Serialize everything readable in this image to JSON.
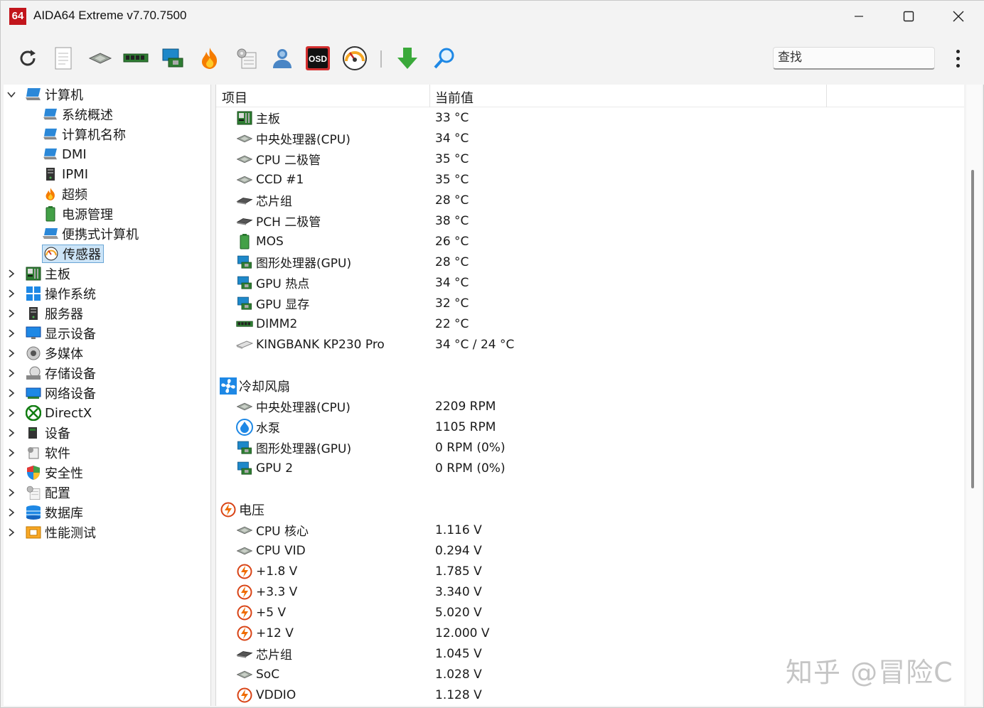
{
  "window": {
    "app_logo": "64",
    "title": "AIDA64 Extreme v7.70.7500"
  },
  "toolbar": {
    "icons": [
      "refresh-icon",
      "report-icon",
      "cpu-icon",
      "memory-icon",
      "gpu-card-icon",
      "overclock-flame-icon",
      "config-icon",
      "user-icon",
      "osd-icon",
      "gauge-icon",
      "download-arrow-icon",
      "search-magnifier-icon"
    ],
    "osd_label": "OSD",
    "search_placeholder": "查找"
  },
  "tree": {
    "root": {
      "label": "计算机",
      "expanded": true
    },
    "children": [
      {
        "label": "系统概述",
        "icon": "computer-icon"
      },
      {
        "label": "计算机名称",
        "icon": "computer-icon"
      },
      {
        "label": "DMI",
        "icon": "computer-icon"
      },
      {
        "label": "IPMI",
        "icon": "server-icon"
      },
      {
        "label": "超频",
        "icon": "flame-icon"
      },
      {
        "label": "电源管理",
        "icon": "battery-icon"
      },
      {
        "label": "便携式计算机",
        "icon": "laptop-icon"
      },
      {
        "label": "传感器",
        "icon": "gauge-icon",
        "selected": true
      }
    ],
    "categories": [
      {
        "label": "主板",
        "icon": "motherboard-icon"
      },
      {
        "label": "操作系统",
        "icon": "windows-icon"
      },
      {
        "label": "服务器",
        "icon": "server-icon"
      },
      {
        "label": "显示设备",
        "icon": "monitor-icon"
      },
      {
        "label": "多媒体",
        "icon": "speaker-icon"
      },
      {
        "label": "存储设备",
        "icon": "storage-icon"
      },
      {
        "label": "网络设备",
        "icon": "network-icon"
      },
      {
        "label": "DirectX",
        "icon": "xbox-icon"
      },
      {
        "label": "设备",
        "icon": "device-icon"
      },
      {
        "label": "软件",
        "icon": "software-icon"
      },
      {
        "label": "安全性",
        "icon": "shield-icon"
      },
      {
        "label": "配置",
        "icon": "config-icon"
      },
      {
        "label": "数据库",
        "icon": "database-icon"
      },
      {
        "label": "性能测试",
        "icon": "benchmark-icon"
      }
    ]
  },
  "panel": {
    "col_item": "项目",
    "col_value": "当前值",
    "temperatures": [
      {
        "name": "主板",
        "value": "33 °C",
        "icon": "motherboard-icon"
      },
      {
        "name": "中央处理器(CPU)",
        "value": "34 °C",
        "icon": "cpu-icon"
      },
      {
        "name": "CPU 二极管",
        "value": "35 °C",
        "icon": "cpu-icon"
      },
      {
        "name": "CCD #1",
        "value": "35 °C",
        "icon": "cpu-icon"
      },
      {
        "name": "芯片组",
        "value": "28 °C",
        "icon": "chip-icon"
      },
      {
        "name": "PCH 二极管",
        "value": "38 °C",
        "icon": "chip-icon"
      },
      {
        "name": "MOS",
        "value": "26 °C",
        "icon": "battery-icon"
      },
      {
        "name": "图形处理器(GPU)",
        "value": "28 °C",
        "icon": "gpu-icon"
      },
      {
        "name": "GPU 热点",
        "value": "34 °C",
        "icon": "gpu-icon"
      },
      {
        "name": "GPU 显存",
        "value": "32 °C",
        "icon": "gpu-icon"
      },
      {
        "name": "DIMM2",
        "value": "22 °C",
        "icon": "memory-icon"
      },
      {
        "name": "KINGBANK KP230 Pro",
        "value": "34 °C / 24 °C",
        "icon": "ssd-icon"
      }
    ],
    "fans_title": "冷却风扇",
    "fans": [
      {
        "name": "中央处理器(CPU)",
        "value": "2209 RPM",
        "icon": "cpu-icon"
      },
      {
        "name": "水泵",
        "value": "1105 RPM",
        "icon": "water-drop-icon"
      },
      {
        "name": "图形处理器(GPU)",
        "value": "0 RPM  (0%)",
        "icon": "gpu-icon"
      },
      {
        "name": "GPU 2",
        "value": "0 RPM  (0%)",
        "icon": "gpu-icon"
      }
    ],
    "voltage_title": "电压",
    "voltages": [
      {
        "name": "CPU 核心",
        "value": "1.116 V",
        "icon": "cpu-icon"
      },
      {
        "name": "CPU VID",
        "value": "0.294 V",
        "icon": "cpu-icon"
      },
      {
        "name": "+1.8 V",
        "value": "1.785 V",
        "icon": "voltage-icon"
      },
      {
        "name": "+3.3 V",
        "value": "3.340 V",
        "icon": "voltage-icon"
      },
      {
        "name": "+5 V",
        "value": "5.020 V",
        "icon": "voltage-icon"
      },
      {
        "name": "+12 V",
        "value": "12.000 V",
        "icon": "voltage-icon"
      },
      {
        "name": "芯片组",
        "value": "1.045 V",
        "icon": "chip-icon"
      },
      {
        "name": "SoC",
        "value": "1.028 V",
        "icon": "cpu-icon"
      },
      {
        "name": "VDDIO",
        "value": "1.128 V",
        "icon": "voltage-icon"
      }
    ]
  },
  "watermark": "知乎 @冒险C"
}
